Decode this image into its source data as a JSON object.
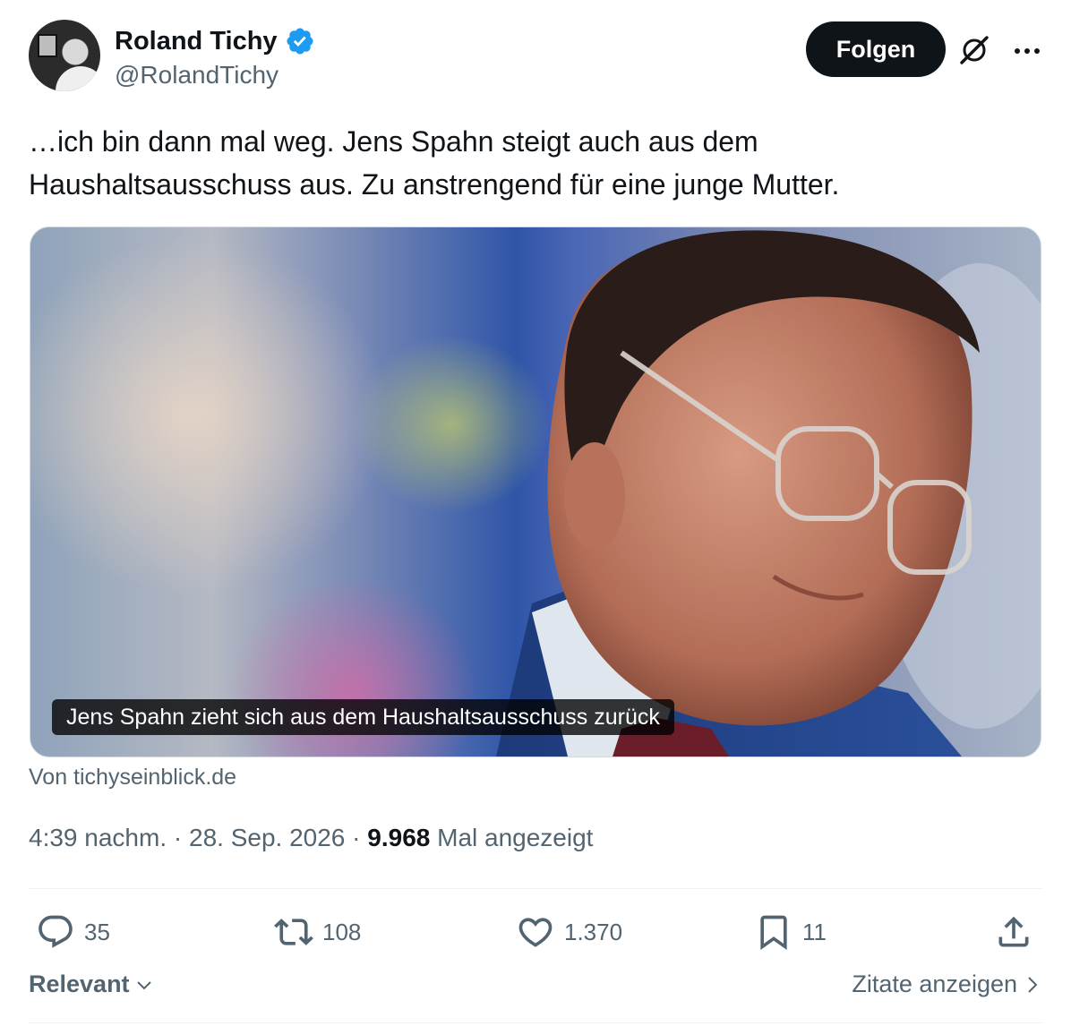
{
  "author": {
    "display_name": "Roland Tichy",
    "handle": "@RolandTichy",
    "verified_color": "#1d9bf0"
  },
  "header": {
    "follow_label": "Folgen",
    "grok_icon": "grok-icon",
    "more_icon": "more-icon"
  },
  "tweet": {
    "text": "…ich bin dann mal weg. Jens Spahn steigt auch aus dem\nHaushaltsausschuss aus. Zu anstrengend für eine junge Mutter."
  },
  "card": {
    "caption": "Jens Spahn zieht sich aus dem Haushaltsausschuss zurück",
    "source": "Von tichyseinblick.de"
  },
  "meta": {
    "time": "4:39 nachm.",
    "sep1": " · ",
    "date": "28. Sep. 2026",
    "sep2": " · ",
    "views": "9.968",
    "views_label": " Mal angezeigt"
  },
  "actions": {
    "replies": "35",
    "reposts": "108",
    "likes": "1.370",
    "bookmarks": "11"
  },
  "footer": {
    "sort_label": "Relevant",
    "quotes_label": "Zitate anzeigen"
  }
}
